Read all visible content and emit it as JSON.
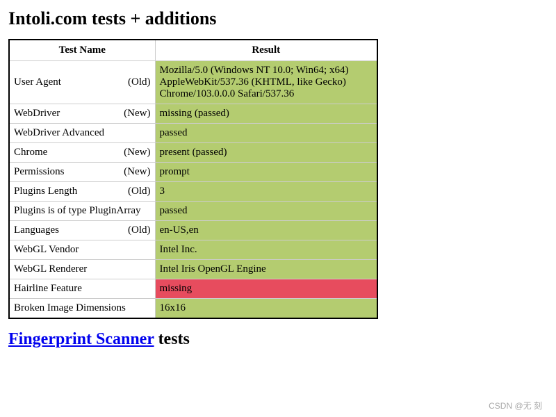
{
  "heading": "Intoli.com tests + additions",
  "table": {
    "headers": {
      "name": "Test Name",
      "result": "Result"
    },
    "rows": [
      {
        "name": "User Agent",
        "tag": "(Old)",
        "result": "Mozilla/5.0 (Windows NT 10.0; Win64; x64) AppleWebKit/537.36 (KHTML, like Gecko) Chrome/103.0.0.0 Safari/537.36",
        "status": "pass"
      },
      {
        "name": "WebDriver",
        "tag": "(New)",
        "result": "missing (passed)",
        "status": "pass"
      },
      {
        "name": "WebDriver Advanced",
        "tag": "",
        "result": "passed",
        "status": "pass"
      },
      {
        "name": "Chrome",
        "tag": "(New)",
        "result": "present (passed)",
        "status": "pass"
      },
      {
        "name": "Permissions",
        "tag": "(New)",
        "result": "prompt",
        "status": "pass"
      },
      {
        "name": "Plugins Length",
        "tag": "(Old)",
        "result": "3",
        "status": "pass"
      },
      {
        "name": "Plugins is of type PluginArray",
        "tag": "",
        "result": "passed",
        "status": "pass"
      },
      {
        "name": "Languages",
        "tag": "(Old)",
        "result": "en-US,en",
        "status": "pass"
      },
      {
        "name": "WebGL Vendor",
        "tag": "",
        "result": "Intel Inc.",
        "status": "pass"
      },
      {
        "name": "WebGL Renderer",
        "tag": "",
        "result": "Intel Iris OpenGL Engine",
        "status": "pass"
      },
      {
        "name": "Hairline Feature",
        "tag": "",
        "result": "missing",
        "status": "fail"
      },
      {
        "name": "Broken Image Dimensions",
        "tag": "",
        "result": "16x16",
        "status": "pass"
      }
    ]
  },
  "section2": {
    "link_text": "Fingerprint Scanner",
    "suffix": " tests"
  },
  "watermark": "CSDN @无 刻"
}
